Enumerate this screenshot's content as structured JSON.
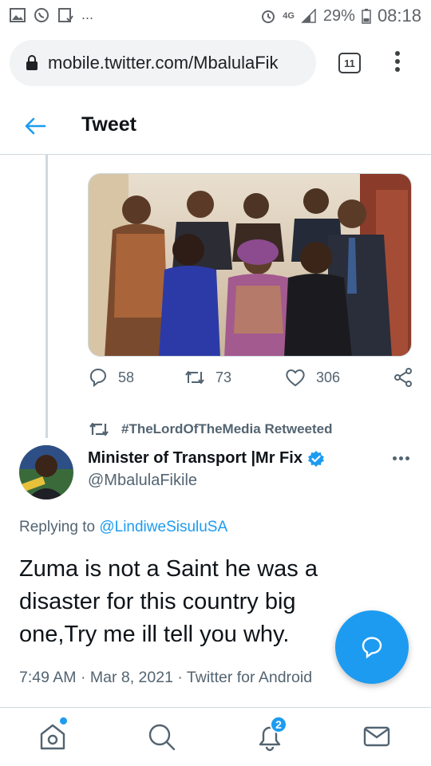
{
  "status_bar": {
    "notification_icons": [
      "gallery-icon",
      "whatsapp-icon",
      "download-icon"
    ],
    "overflow": "...",
    "network": "4G",
    "battery": "29%",
    "time": "08:18"
  },
  "browser": {
    "url": "mobile.twitter.com/MbalulaFik",
    "tab_count": "11"
  },
  "header": {
    "title": "Tweet"
  },
  "previous_tweet": {
    "replies": "58",
    "retweets": "73",
    "likes": "306"
  },
  "retweet_context": {
    "label": "#TheLordOfTheMedia Retweeted"
  },
  "tweet": {
    "display_name": "Minister of Transport |Mr Fix",
    "handle": "@MbalulaFikile",
    "replying_prefix": "Replying to",
    "replying_to": "@LindiweSisuluSA",
    "text": "Zuma is not a Saint he was a disaster for this country big one,Try me ill tell you why.",
    "timestamp": "7:49 AM · Mar 8, 2021 · Twitter for Android"
  },
  "bottom_nav": {
    "notifications_badge": "2"
  },
  "colors": {
    "accent": "#1d9bf0",
    "text_primary": "#0f1419",
    "text_secondary": "#536471",
    "border": "#cfd9de"
  }
}
